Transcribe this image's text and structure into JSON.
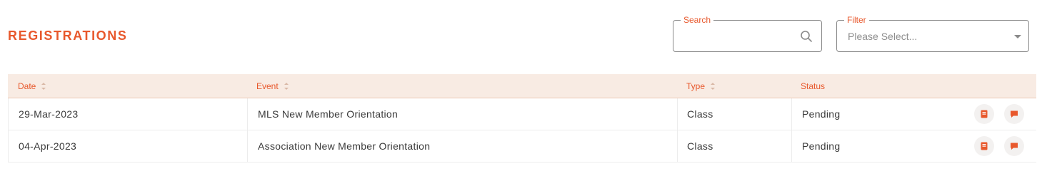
{
  "header": {
    "title": "REGISTRATIONS"
  },
  "search": {
    "label": "Search",
    "value": "",
    "icon": "search-icon"
  },
  "filter": {
    "label": "Filter",
    "placeholder": "Please Select...",
    "icon": "chevron-down-icon"
  },
  "table": {
    "columns": [
      {
        "label": "Date",
        "sortable": true
      },
      {
        "label": "Event",
        "sortable": true
      },
      {
        "label": "Type",
        "sortable": true
      },
      {
        "label": "Status",
        "sortable": false
      }
    ],
    "rows": [
      {
        "date": "29-Mar-2023",
        "event": "MLS New Member Orientation",
        "type": "Class",
        "status": "Pending"
      },
      {
        "date": "04-Apr-2023",
        "event": "Association New Member Orientation",
        "type": "Class",
        "status": "Pending"
      }
    ],
    "row_actions": [
      {
        "icon": "book-icon"
      },
      {
        "icon": "chat-icon"
      }
    ]
  },
  "colors": {
    "accent": "#e8582c",
    "header_bg": "#f8ebe3",
    "text": "#3a3a3a"
  }
}
